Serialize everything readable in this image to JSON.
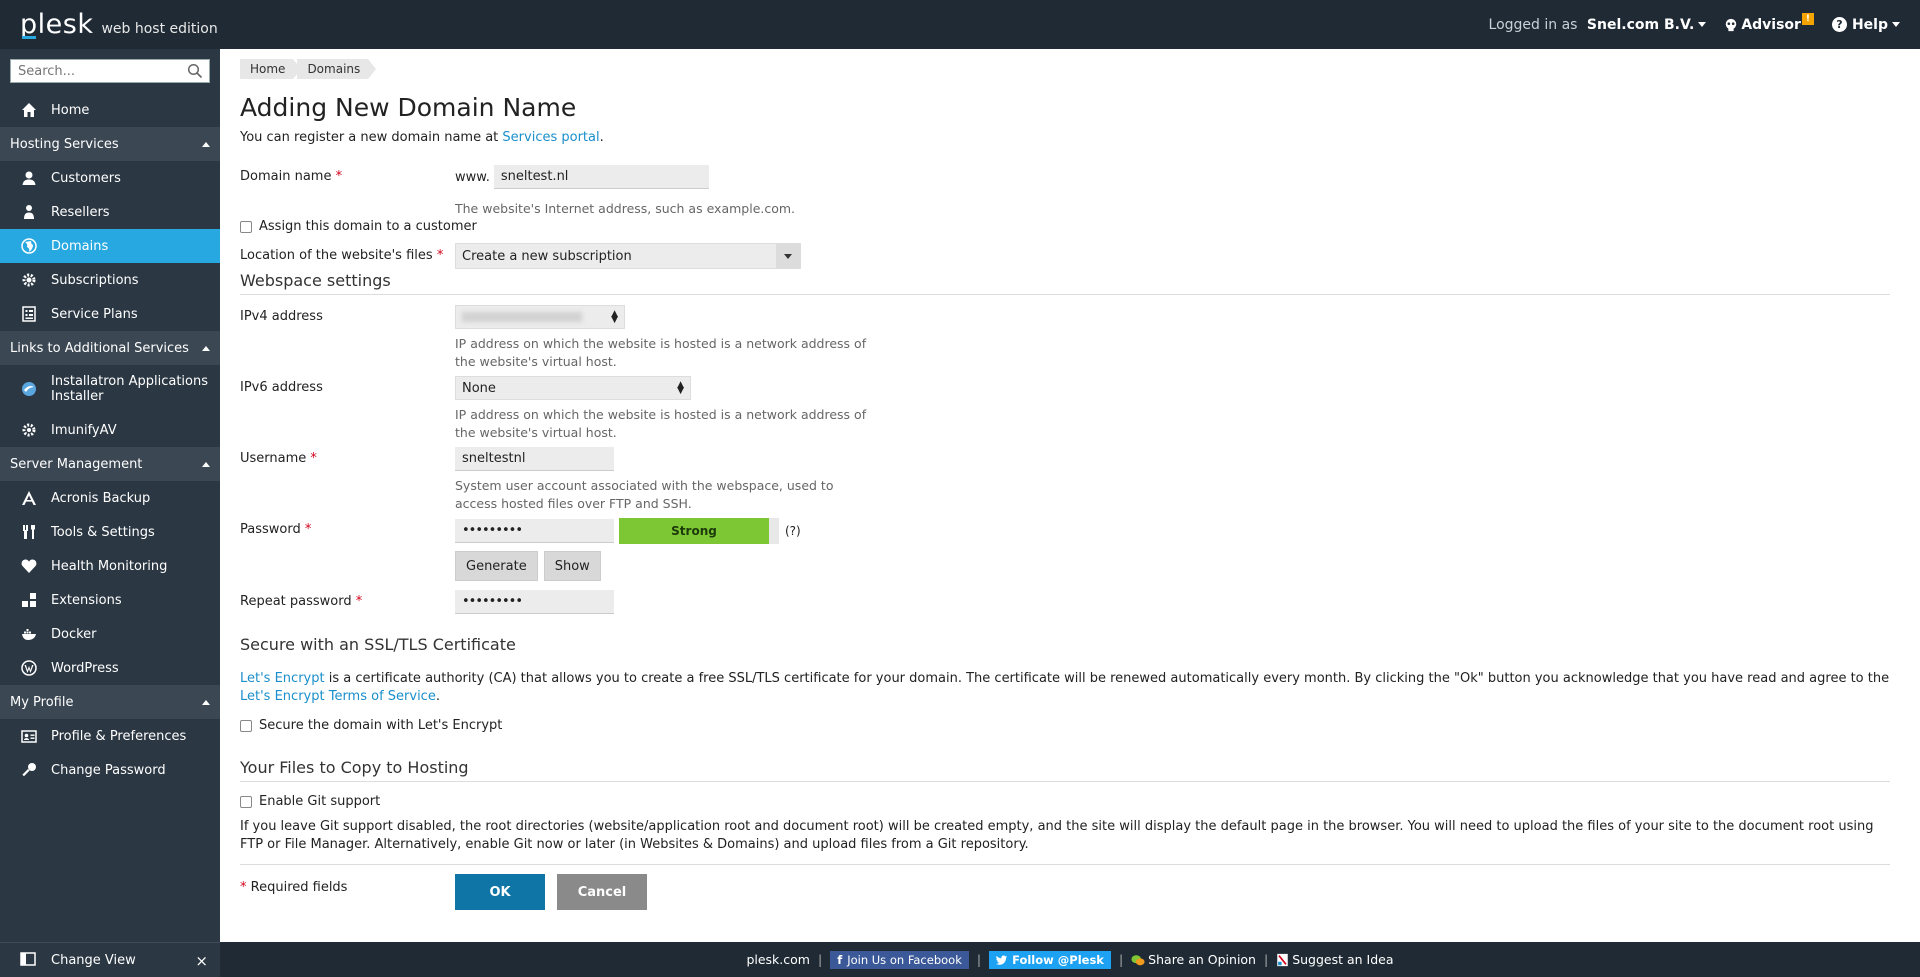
{
  "topbar": {
    "brand": "plesk",
    "edition": "web host edition",
    "logged_in_prefix": "Logged in as",
    "user": "Snel.com B.V.",
    "advisor": "Advisor",
    "advisor_badge": "!",
    "help": "Help"
  },
  "sidebar": {
    "search_placeholder": "Search...",
    "home": "Home",
    "sections": {
      "hosting": "Hosting Services",
      "links": "Links to Additional Services",
      "server": "Server Management",
      "profile": "My Profile"
    },
    "hosting_items": [
      "Customers",
      "Resellers",
      "Domains",
      "Subscriptions",
      "Service Plans"
    ],
    "links_items": [
      "Installatron Applications Installer",
      "ImunifyAV"
    ],
    "server_items": [
      "Acronis Backup",
      "Tools & Settings",
      "Health Monitoring",
      "Extensions",
      "Docker",
      "WordPress"
    ],
    "profile_items": [
      "Profile & Preferences",
      "Change Password"
    ],
    "change_view": "Change View"
  },
  "breadcrumb": [
    "Home",
    "Domains"
  ],
  "page": {
    "title": "Adding New Domain Name",
    "register_prefix": "You can register a new domain name at",
    "register_link": "Services portal",
    "register_suffix": "."
  },
  "form": {
    "domain_label": "Domain name",
    "www_prefix": "www.",
    "domain_value": "sneltest.nl",
    "domain_hint": "The website's Internet address, such as example.com.",
    "assign_label": "Assign this domain to a customer",
    "location_label": "Location of the website's files",
    "location_value": "Create a new subscription",
    "webspace_title": "Webspace settings",
    "ipv4_label": "IPv4 address",
    "ipv4_value": "",
    "ipv4_hint": "IP address on which the website is hosted is a network address of the website's virtual host.",
    "ipv6_label": "IPv6 address",
    "ipv6_value": "None",
    "ipv6_hint": "IP address on which the website is hosted is a network address of the website's virtual host.",
    "username_label": "Username",
    "username_value": "sneltestnl",
    "username_hint": "System user account associated with the webspace, used to access hosted files over FTP and SSH.",
    "password_label": "Password",
    "password_value": "•••••••••",
    "strength": "Strong",
    "strength_help": "(?)",
    "generate": "Generate",
    "show": "Show",
    "repeat_label": "Repeat password",
    "repeat_value": "•••••••••",
    "ssl_title": "Secure with an SSL/TLS Certificate",
    "ssl_link": "Let's Encrypt",
    "ssl_text": "is a certificate authority (CA) that allows you to create a free SSL/TLS certificate for your domain. The certificate will be renewed automatically every month. By clicking the \"Ok\" button you acknowledge that you have read and agree to the",
    "ssl_terms_link": "Let's Encrypt Terms of Service",
    "ssl_terms_suffix": ".",
    "ssl_check": "Secure the domain with Let's Encrypt",
    "files_title": "Your Files to Copy to Hosting",
    "git_check": "Enable Git support",
    "git_text": "If you leave Git support disabled, the root directories (website/application root and document root) will be created empty, and the site will display the default page in the browser. You will need to upload the files of your site to the document root using FTP or File Manager. Alternatively, enable Git now or later (in Websites & Domains) and upload files from a Git repository.",
    "required_star": "*",
    "required_text": "Required fields",
    "ok": "OK",
    "cancel": "Cancel"
  },
  "footer": {
    "site": "plesk.com",
    "facebook": "Join Us on Facebook",
    "twitter": "Follow @Plesk",
    "opinion": "Share an Opinion",
    "idea": "Suggest an Idea"
  },
  "colors": {
    "topbar": "#1f2a34",
    "sidebar": "#2b3743",
    "active": "#27a8e0",
    "link": "#1a8fcb",
    "ok_button": "#0f75a7",
    "strong": "#7dc634"
  }
}
